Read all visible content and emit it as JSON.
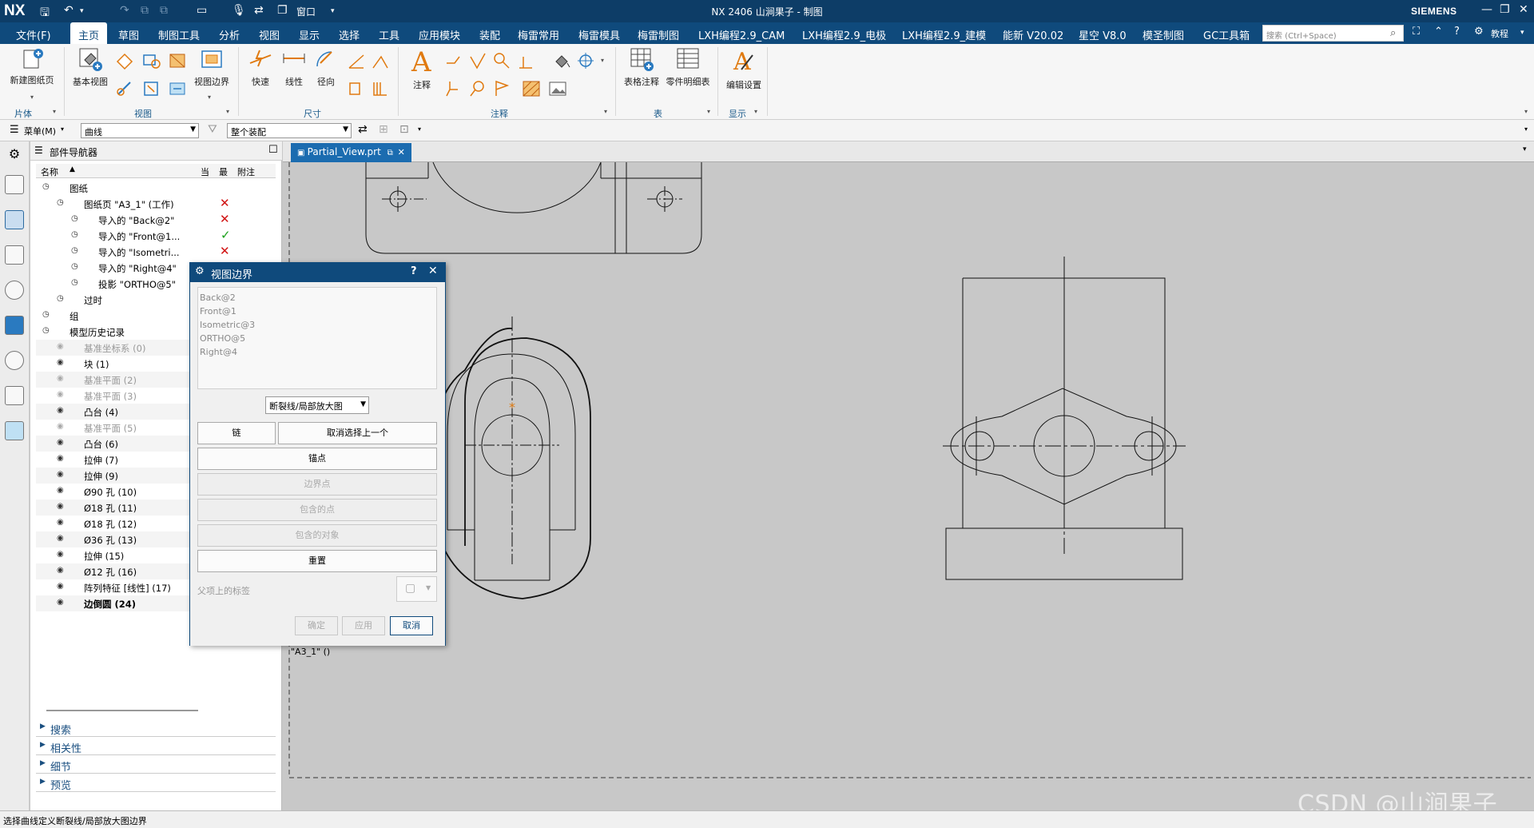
{
  "titlebar": {
    "logo": "NX",
    "title": "NX 2406 山涧果子 - 制图",
    "brand": "SIEMENS",
    "window_menu": "窗口",
    "win_min": "—",
    "win_restore": "❐",
    "win_close": "✕"
  },
  "menubar": {
    "items": [
      "文件(F)",
      "主页",
      "草图",
      "制图工具",
      "分析",
      "视图",
      "显示",
      "选择",
      "工具",
      "应用模块",
      "装配",
      "梅雷常用",
      "梅雷模具",
      "梅雷制图",
      "LXH编程2.9_CAM",
      "LXH编程2.9_电极",
      "LXH编程2.9_建模",
      "能新 V20.02",
      "星空 V8.0",
      "模圣制图",
      "GC工具箱"
    ],
    "active_index": 1,
    "search_placeholder": "搜索 (Ctrl+Space)",
    "help_label": "教程"
  },
  "ribbon": {
    "groups": [
      "片体",
      "视图",
      "尺寸",
      "注释",
      "表",
      "显示"
    ],
    "buttons": {
      "new_sheet": "新建图纸页",
      "base_view": "基本视图",
      "view_boundary": "视图边界",
      "quick": "快速",
      "linear": "线性",
      "radial": "径向",
      "note": "注释",
      "table_note": "表格注释",
      "parts_list": "零件明细表",
      "edit_settings": "编辑设置"
    }
  },
  "selbar": {
    "menu_label": "菜单(M)",
    "filter": "曲线",
    "scope": "整个装配"
  },
  "navigator": {
    "title": "部件导航器",
    "col_name": "名称",
    "col_current": "当",
    "col_latest": "最",
    "col_note": "附注",
    "rows": [
      {
        "label": "图纸",
        "indent": 0,
        "gray": false
      },
      {
        "label": "图纸页 \"A3_1\" (工作)",
        "indent": 1,
        "gray": false,
        "mark": "x"
      },
      {
        "label": "导入的 \"Back@2\"",
        "indent": 2,
        "gray": false,
        "mark": "x"
      },
      {
        "label": "导入的 \"Front@1...",
        "indent": 2,
        "gray": false,
        "mark": "check"
      },
      {
        "label": "导入的 \"Isometri...",
        "indent": 2,
        "gray": false,
        "mark": "x"
      },
      {
        "label": "导入的 \"Right@4\"",
        "indent": 2,
        "gray": false,
        "mark": ""
      },
      {
        "label": "投影 \"ORTHO@5\"",
        "indent": 2,
        "gray": false,
        "mark": ""
      },
      {
        "label": "过时",
        "indent": 1,
        "gray": false,
        "mark": ""
      },
      {
        "label": "组",
        "indent": 0,
        "gray": false,
        "mark": ""
      },
      {
        "label": "模型历史记录",
        "indent": 0,
        "gray": false,
        "mark": ""
      },
      {
        "label": "基准坐标系 (0)",
        "indent": 1,
        "gray": true,
        "mark": ""
      },
      {
        "label": "块 (1)",
        "indent": 1,
        "gray": false,
        "mark": ""
      },
      {
        "label": "基准平面 (2)",
        "indent": 1,
        "gray": true,
        "mark": ""
      },
      {
        "label": "基准平面 (3)",
        "indent": 1,
        "gray": true,
        "mark": ""
      },
      {
        "label": "凸台 (4)",
        "indent": 1,
        "gray": false,
        "mark": ""
      },
      {
        "label": "基准平面 (5)",
        "indent": 1,
        "gray": true,
        "mark": ""
      },
      {
        "label": "凸台 (6)",
        "indent": 1,
        "gray": false,
        "mark": ""
      },
      {
        "label": "拉伸 (7)",
        "indent": 1,
        "gray": false,
        "mark": ""
      },
      {
        "label": "拉伸 (9)",
        "indent": 1,
        "gray": false,
        "mark": ""
      },
      {
        "label": "Ø90 孔 (10)",
        "indent": 1,
        "gray": false,
        "mark": ""
      },
      {
        "label": "Ø18 孔 (11)",
        "indent": 1,
        "gray": false,
        "mark": ""
      },
      {
        "label": "Ø18 孔 (12)",
        "indent": 1,
        "gray": false,
        "mark": ""
      },
      {
        "label": "Ø36 孔 (13)",
        "indent": 1,
        "gray": false,
        "mark": ""
      },
      {
        "label": "拉伸 (15)",
        "indent": 1,
        "gray": false,
        "mark": ""
      },
      {
        "label": "Ø12 孔 (16)",
        "indent": 1,
        "gray": false,
        "mark": ""
      },
      {
        "label": "阵列特征 [线性] (17)",
        "indent": 1,
        "gray": false,
        "mark": ""
      },
      {
        "label": "边倒圆 (24)",
        "indent": 1,
        "gray": false,
        "bold": true,
        "mark": ""
      }
    ],
    "sections": [
      "搜索",
      "相关性",
      "细节",
      "预览"
    ]
  },
  "tab": {
    "label": "Partial_View.prt"
  },
  "dialog": {
    "title": "视图边界",
    "help": "?",
    "close": "✕",
    "views": [
      "Back@2",
      "Front@1",
      "Isometric@3",
      "ORTHO@5",
      "Right@4"
    ],
    "type_value": "断裂线/局部放大图",
    "chain": "链",
    "deselect_last": "取消选择上一个",
    "anchor": "锚点",
    "boundary_point": "边界点",
    "contained_point": "包含的点",
    "contained_object": "包含的对象",
    "reset": "重置",
    "parent_label": "父项上的标签",
    "ok": "确定",
    "apply": "应用",
    "cancel": "取消"
  },
  "canvas": {
    "sheet_label": "\"A3_1\"  ()"
  },
  "status": {
    "text": "选择曲线定义断裂线/局部放大图边界"
  },
  "watermark": "CSDN @山涧果子"
}
